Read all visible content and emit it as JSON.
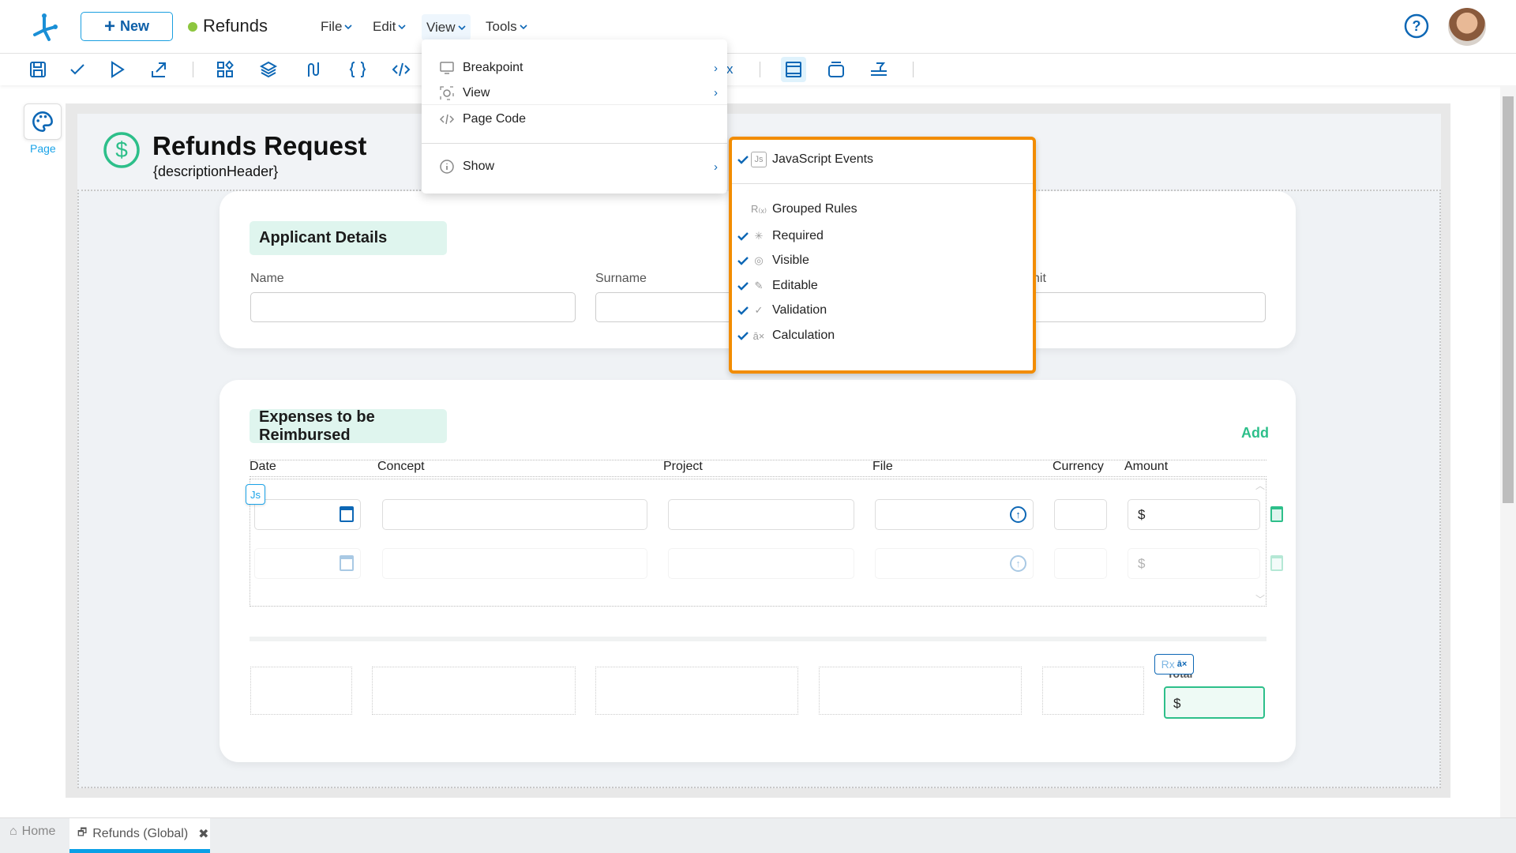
{
  "app": {
    "new_label": "New",
    "doc_title": "Refunds",
    "status_color": "#8dc63f"
  },
  "menubar": [
    {
      "label": "File"
    },
    {
      "label": "Edit"
    },
    {
      "label": "View"
    },
    {
      "label": "Tools"
    }
  ],
  "toolbar": {
    "icons": [
      "save-icon",
      "check-icon",
      "play-icon",
      "export-icon",
      "components-icon",
      "layers-icon",
      "flow-icon",
      "braces-icon",
      "code-icon",
      "layout-icon",
      "container-icon",
      "filter-icon"
    ],
    "partial_text": "x"
  },
  "left_panel": {
    "page_label": "Page"
  },
  "form": {
    "title": "Refunds Request",
    "subtitle": "{descriptionHeader}",
    "applicant": {
      "section_title": "Applicant Details",
      "fields": [
        {
          "label": "Name"
        },
        {
          "label": "Surname"
        },
        {
          "label": "nit"
        }
      ]
    },
    "expenses": {
      "section_title": "Expenses to be Reimbursed",
      "add_label": "Add",
      "columns": [
        "Date",
        "Concept",
        "Project",
        "File",
        "Currency",
        "Amount"
      ],
      "currency_symbol": "$",
      "js_badge": "Js"
    },
    "totals": {
      "label": "Total",
      "currency_symbol": "$",
      "rx_badge": "Rx"
    }
  },
  "view_menu": {
    "items": [
      {
        "label": "Breakpoint",
        "icon": "monitor-icon",
        "submenu": true
      },
      {
        "label": "View",
        "icon": "view-icon",
        "submenu": true
      },
      {
        "label": "Page Code",
        "icon": "code-icon",
        "submenu": false
      },
      {
        "label": "Show",
        "icon": "info-icon",
        "submenu": true
      }
    ]
  },
  "show_submenu": {
    "items": [
      {
        "label": "JavaScript Events",
        "icon": "js-icon",
        "checked": true
      },
      {
        "label": "Grouped Rules",
        "icon": "rules-icon",
        "checked": false
      },
      {
        "label": "Required",
        "icon": "asterisk-icon",
        "checked": true
      },
      {
        "label": "Visible",
        "icon": "eye-icon",
        "checked": true
      },
      {
        "label": "Editable",
        "icon": "pencil-icon",
        "checked": true
      },
      {
        "label": "Validation",
        "icon": "check-icon",
        "checked": true
      },
      {
        "label": "Calculation",
        "icon": "calculation-icon",
        "checked": true
      }
    ],
    "js_glyph": "Js",
    "rules_glyph": "R(x)"
  },
  "bottom_tabs": [
    {
      "label": "Home",
      "active": false
    },
    {
      "label": "Refunds (Global)",
      "active": true
    }
  ],
  "colors": {
    "primary": "#0d67b5",
    "accent_green": "#2dbf8a",
    "highlight": "#f28c00",
    "tab_active": "#0aa0e6"
  }
}
